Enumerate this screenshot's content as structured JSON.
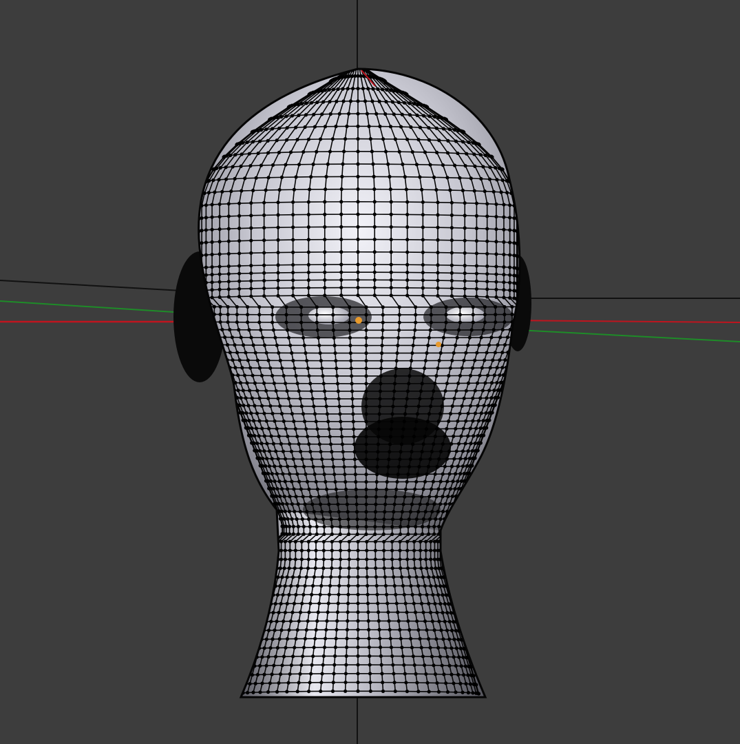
{
  "viewport": {
    "background_color": "#3d3d3d",
    "mode": "edit-mode-wireframe-overlay",
    "object": "head-mesh"
  },
  "axes": {
    "x_axis_color": "#c0141e",
    "y_axis_color": "#1e8c28",
    "z_axis_color": "#111111"
  },
  "mesh": {
    "surface_color": "#c8c8d0",
    "wire_color": "#050505",
    "vertex_color": "#000000",
    "selected_vertex_color": "#e89a2c"
  }
}
